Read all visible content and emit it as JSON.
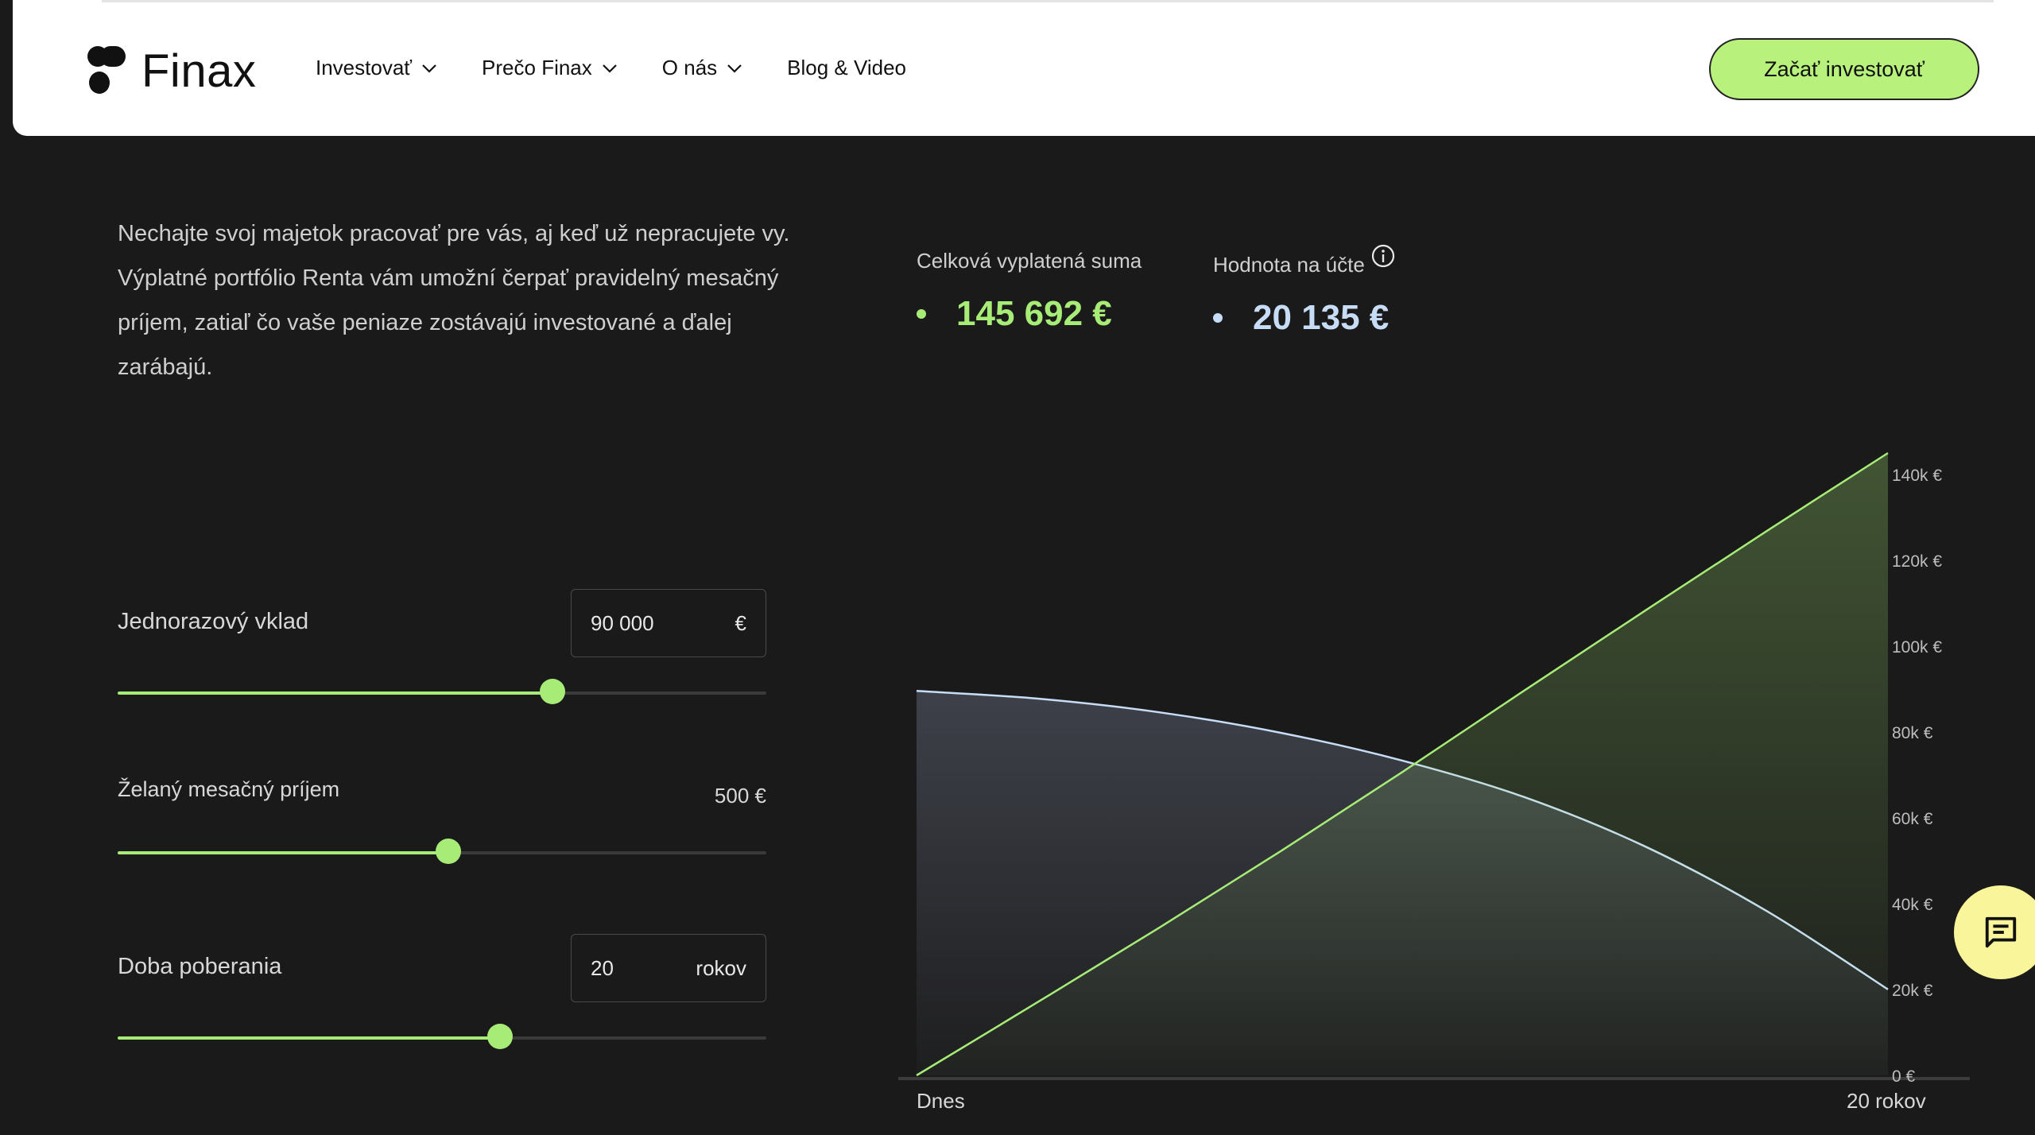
{
  "brand": {
    "name": "Finax"
  },
  "nav": {
    "items": [
      {
        "label": "Investovať",
        "has_dropdown": true
      },
      {
        "label": "Prečo Finax",
        "has_dropdown": true
      },
      {
        "label": "O nás",
        "has_dropdown": true
      },
      {
        "label": "Blog & Video",
        "has_dropdown": false
      }
    ],
    "cta_label": "Začať investovať"
  },
  "intro": {
    "text": "Nechajte svoj majetok pracovať pre vás, aj keď už nepracujete vy. Výplatné portfólio Renta vám umožní čerpať pravidelný mesačný príjem, zatiaľ čo vaše peniaze zostávajú investované a ďalej zarábajú."
  },
  "calculator": {
    "deposit": {
      "label": "Jednorazový vklad",
      "value": "90 000",
      "unit": "€",
      "slider_fraction": 0.67
    },
    "monthly_income": {
      "label": "Želaný mesačný príjem",
      "value": "500 €",
      "slider_fraction": 0.51
    },
    "duration": {
      "label": "Doba poberania",
      "value": "20",
      "unit": "rokov",
      "slider_fraction": 0.59
    }
  },
  "stats": {
    "total_paid": {
      "label": "Celková vyplatená suma",
      "value": "145 692 €",
      "color": "#a7ec76"
    },
    "account_value": {
      "label": "Hodnota na účte",
      "value": "20 135 €",
      "color": "#c7dcf5"
    }
  },
  "chart_data": {
    "type": "area",
    "x_start_label": "Dnes",
    "x_end_label": "20 rokov",
    "x": [
      0,
      2.5,
      5,
      7.5,
      10,
      12.5,
      15,
      17.5,
      20
    ],
    "y_ticks": [
      "0 €",
      "20k €",
      "40k €",
      "60k €",
      "80k €",
      "100k €",
      "120k €",
      "140k €"
    ],
    "ylim": [
      0,
      145692
    ],
    "series": [
      {
        "values": [
          0,
          17200,
          34600,
          52500,
          71000,
          90000,
          108800,
          127400,
          145692
        ],
        "color": "#a7ec76"
      },
      {
        "values": [
          90000,
          88200,
          85000,
          80200,
          73700,
          65200,
          53600,
          38500,
          20135
        ],
        "color": "#c7dcf5"
      }
    ]
  },
  "chat": {
    "icon": "chat-icon"
  }
}
